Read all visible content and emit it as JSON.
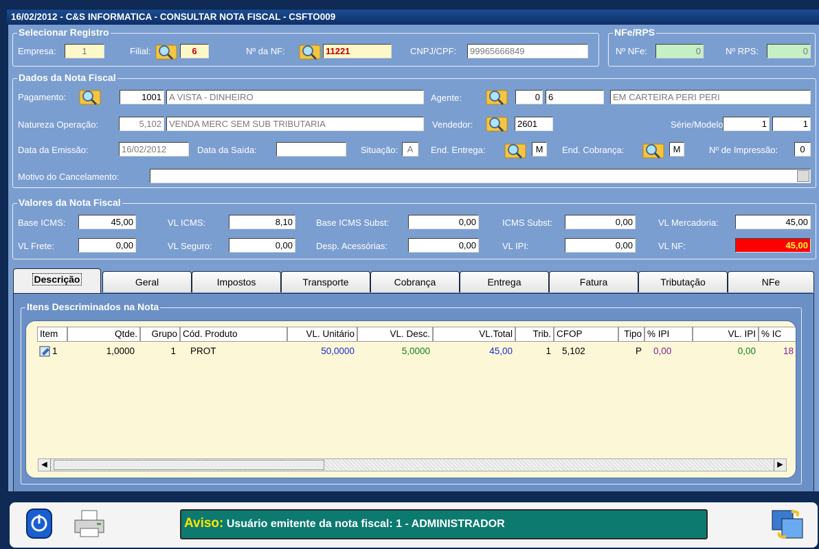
{
  "window": {
    "title": "16/02/2012 - C&S INFORMATICA - CONSULTAR NOTA FISCAL - CSFTO009"
  },
  "selecionar": {
    "title": "Selecionar Registro",
    "empresa_label": "Empresa:",
    "empresa": "1",
    "filial_label": "Filial:",
    "filial": "6",
    "nf_label": "Nº da NF:",
    "nf": "11221",
    "cnpj_label": "CNPJ/CPF:",
    "cnpj": "99965666849"
  },
  "nfe": {
    "title": "NFe/RPS",
    "nfe_label": "Nº NFe:",
    "nfe": "0",
    "rps_label": "Nº RPS:",
    "rps": "0"
  },
  "dados": {
    "title": "Dados da Nota Fiscal",
    "pagamento_label": "Pagamento:",
    "pagamento_cod": "1001",
    "pagamento_desc": "A VISTA - DINHEIRO",
    "agente_label": "Agente:",
    "agente_cod": "0",
    "agente_cod2": "6",
    "agente_desc": "EM CARTEIRA PERI PERI",
    "natureza_label": "Natureza Operação:",
    "natureza_cod": "5,102",
    "natureza_desc": "VENDA MERC SEM SUB TRIBUTARIA",
    "vendedor_label": "Vendedor:",
    "vendedor": "2601",
    "serie_label": "Série/Modelo:",
    "serie": "1",
    "modelo": "1",
    "emissao_label": "Data da  Emissão:",
    "emissao": "16/02/2012",
    "saida_label": "Data da Saída:",
    "saida": "",
    "situacao_label": "Situação:",
    "situacao": "A",
    "entrega_label": "End.  Entrega:",
    "entrega": "M",
    "cobranca_label": "End. Cobrança:",
    "cobranca": "M",
    "impressao_label": "Nº de Impressão:",
    "impressao": "0",
    "motivo_label": "Motivo do Cancelamento:",
    "motivo": ""
  },
  "valores": {
    "title": "Valores da Nota Fiscal",
    "base_icms_label": "Base ICMS:",
    "base_icms": "45,00",
    "vl_icms_label": "VL ICMS:",
    "vl_icms": "8,10",
    "base_subst_label": "Base ICMS Subst:",
    "base_subst": "0,00",
    "icms_subst_label": "ICMS Subst:",
    "icms_subst": "0,00",
    "vl_merc_label": "VL Mercadoria:",
    "vl_merc": "45,00",
    "vl_frete_label": "VL Frete:",
    "vl_frete": "0,00",
    "vl_seguro_label": "VL Seguro:",
    "vl_seguro": "0,00",
    "desp_label": "Desp. Acessórias:",
    "desp": "0,00",
    "vl_ipi_label": "VL IPI:",
    "vl_ipi": "0,00",
    "vl_nf_label": "VL NF:",
    "vl_nf": "45,00"
  },
  "tabs": [
    "Descrição",
    "Geral",
    "Impostos",
    "Transporte",
    "Cobrança",
    "Entrega",
    "Fatura",
    "Tributação",
    "NFe"
  ],
  "itens": {
    "title": "Itens Descriminados na Nota",
    "columns": [
      "Item",
      "Qtde.",
      "Grupo",
      "Cód. Produto",
      "VL. Unitário",
      "VL. Desc.",
      "VL.Total",
      "Trib.",
      "CFOP",
      "Tipo",
      "% IPI",
      "VL. IPI",
      "% IC"
    ],
    "rows": [
      {
        "item": "1",
        "qtde": "1,0000",
        "grupo": "1",
        "cod": "PROT",
        "unit": "50,0000",
        "desc": "5,0000",
        "total": "45,00",
        "trib": "1",
        "cfop": "5,102",
        "tipo": "P",
        "ipi": "0,00",
        "vlipi": "0,00",
        "ic": "18"
      }
    ]
  },
  "status": {
    "aviso_key": "Aviso:",
    "aviso_msg": "Usuário emitente da nota fiscal: 1 - ADMINISTRADOR"
  },
  "colors": {
    "panel": "#7b9ed0",
    "title": "#0f2f66",
    "nf_total_bg": "#ff0000",
    "status_bg": "#0d7a70"
  }
}
